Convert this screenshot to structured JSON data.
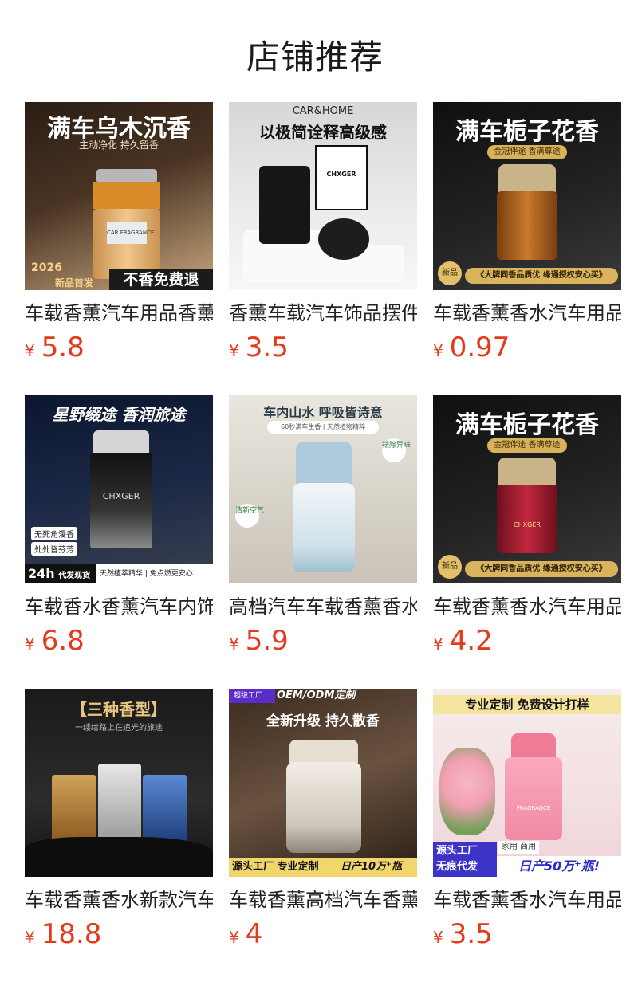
{
  "section_title": "店铺推荐",
  "currency_symbol": "¥",
  "products": [
    {
      "name": "车载香薰汽车用品香薰",
      "price": "5.8",
      "image": {
        "headline": "满车乌木沉香",
        "sub": "主动净化 持久留香",
        "bottle_label": "CAR FRAGRANCE",
        "badge_year": "2026",
        "badge_new": "新品首发",
        "banner": "不香免费退"
      }
    },
    {
      "name": "香薰车载汽车饰品摆件",
      "price": "3.5",
      "image": {
        "brand": "CAR&HOME",
        "headline": "以极简诠释高级感",
        "box_label": "CHXGER"
      }
    },
    {
      "name": "车载香薰香水汽车用品",
      "price": "0.97",
      "image": {
        "headline": "满车栀子花香",
        "sub": "金冠伴途 香满尊途",
        "badge": "新品",
        "banner": "《大牌同香品质优 缘通授权安心买》"
      }
    },
    {
      "name": "车载香水香薰汽车内饰",
      "price": "6.8",
      "image": {
        "headline": "星野缀途 香润旅途",
        "bottle_label": "CHXGER",
        "tag1": "无死角漫香",
        "tag2": "处处皆芬芳",
        "banner_left": "24h",
        "banner_left2": "代发现货",
        "banner_right": "天然植萃精华 | 免点燃更安心"
      }
    },
    {
      "name": "高档汽车车载香薰香水",
      "price": "5.9",
      "image": {
        "headline": "车内山水 呼吸皆诗意",
        "sub": "60秒满车生香 | 天然植物精粹",
        "tag1": "祛除异味",
        "tag2": "清新空气"
      }
    },
    {
      "name": "车载香薰香水汽车用品",
      "price": "4.2",
      "image": {
        "headline": "满车栀子花香",
        "sub": "金冠伴途 香满尊途",
        "bottle_label": "CHXGER",
        "badge": "新品",
        "banner": "《大牌同香品质优 缘通授权安心买》"
      }
    },
    {
      "name": "车载香薰香水新款汽车",
      "price": "18.8",
      "image": {
        "headline": "【三种香型】",
        "sub": "一缕给路上在追光的旅途"
      }
    },
    {
      "name": "车载香薰高档汽车香薰",
      "price": "4",
      "image": {
        "corner": "超级工厂",
        "oem": "OEM/ODM定制",
        "headline": "全新升级 持久散香",
        "banner_left": "源头工厂 专业定制",
        "banner_right": "日产10万⁺瓶"
      }
    },
    {
      "name": "车载香薰香水汽车用品",
      "price": "3.5",
      "image": {
        "headline": "专业定制 免费设计打样",
        "bottle_label": "FRAGRANCE",
        "tag_top": "家用 商用",
        "banner_left": "源头工厂",
        "banner_left2": "无痕代发",
        "banner_right": "日产50万⁺瓶!"
      }
    }
  ]
}
